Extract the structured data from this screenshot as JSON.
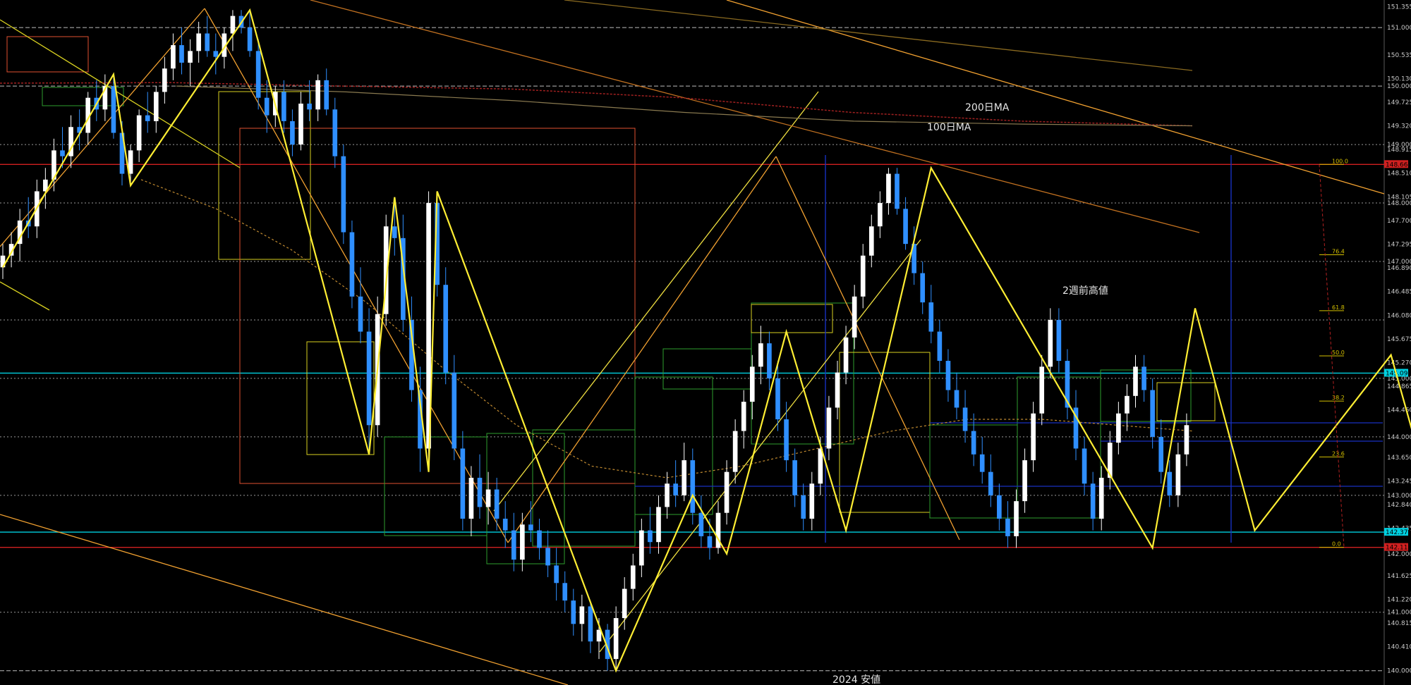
{
  "annotations": {
    "ma200": "200日MA",
    "ma100": "100日MA",
    "two_week_high": "2週前高値",
    "low_2024": "2024 安値"
  },
  "chart_data": {
    "type": "candlestick",
    "instrument_hint": "",
    "ylim": [
      139.9,
      151.4
    ],
    "y_ticks": [
      "151.355",
      "151.000",
      "150.535",
      "150.130",
      "150.000",
      "149.725",
      "149.320",
      "149.000",
      "148.915",
      "148.510",
      "148.105",
      "148.000",
      "147.700",
      "147.295",
      "147.000",
      "146.890",
      "146.485",
      "146.080",
      "145.675",
      "145.270",
      "145.000",
      "144.865",
      "144.460",
      "144.000",
      "143.650",
      "143.245",
      "143.000",
      "142.840",
      "142.435",
      "142.000",
      "141.625",
      "141.220",
      "141.000",
      "140.815",
      "140.410",
      "140.000"
    ],
    "horizontal_levels": [
      {
        "price": 151.0,
        "style": "dashed",
        "color": "#bdbdbd"
      },
      {
        "price": 150.0,
        "style": "dashed",
        "color": "#bdbdbd"
      },
      {
        "price": 149.0,
        "style": "dotted",
        "color": "#9a9a9a"
      },
      {
        "price": 148.66,
        "style": "solid",
        "color": "#d02020",
        "tag": "148.660"
      },
      {
        "price": 148.0,
        "style": "dotted",
        "color": "#9a9a9a"
      },
      {
        "price": 147.0,
        "style": "dotted",
        "color": "#9a9a9a"
      },
      {
        "price": 146.0,
        "style": "dotted",
        "color": "#9a9a9a"
      },
      {
        "price": 145.09,
        "style": "solid",
        "color": "#00d0e0",
        "tag": "145.093"
      },
      {
        "price": 145.0,
        "style": "dotted",
        "color": "#9a9a9a"
      },
      {
        "price": 144.0,
        "style": "dotted",
        "color": "#9a9a9a"
      },
      {
        "price": 143.0,
        "style": "dotted",
        "color": "#9a9a9a"
      },
      {
        "price": 142.37,
        "style": "solid",
        "color": "#00d0e0",
        "tag": "142.375"
      },
      {
        "price": 142.11,
        "style": "solid",
        "color": "#d02020",
        "tag": "142.111"
      },
      {
        "price": 141.0,
        "style": "dotted",
        "color": "#9a9a9a"
      },
      {
        "price": 140.0,
        "style": "dashed",
        "color": "#bdbdbd"
      }
    ],
    "fibonacci": {
      "high": 148.66,
      "low": 142.11,
      "levels": [
        {
          "ratio": 1.0,
          "label": "100.0"
        },
        {
          "ratio": 0.764,
          "label": "76.4"
        },
        {
          "ratio": 0.618,
          "label": "61.8"
        },
        {
          "ratio": 0.5,
          "label": "50.0"
        },
        {
          "ratio": 0.382,
          "label": "38.2"
        },
        {
          "ratio": 0.236,
          "label": "23.6"
        },
        {
          "ratio": 0.0,
          "label": "0.0"
        }
      ]
    },
    "zigzag": [
      {
        "i": 0,
        "p": 146.9
      },
      {
        "i": 13,
        "p": 150.2
      },
      {
        "i": 15,
        "p": 148.3
      },
      {
        "i": 29,
        "p": 151.3
      },
      {
        "i": 43,
        "p": 143.7
      },
      {
        "i": 46,
        "p": 148.1
      },
      {
        "i": 50,
        "p": 143.4
      },
      {
        "i": 51,
        "p": 148.2
      },
      {
        "i": 72,
        "p": 140.0
      },
      {
        "i": 81,
        "p": 143.0
      },
      {
        "i": 85,
        "p": 142.0
      },
      {
        "i": 92,
        "p": 145.8
      },
      {
        "i": 99,
        "p": 142.4
      },
      {
        "i": 109,
        "p": 148.6
      },
      {
        "i": 135,
        "p": 142.1
      },
      {
        "i": 140,
        "p": 146.2
      },
      {
        "i": 147,
        "p": 142.4
      },
      {
        "i": 163,
        "p": 145.4
      },
      {
        "i": 168,
        "p": 142.8
      },
      {
        "i": 169,
        "p": 144.4
      }
    ],
    "ma200": [
      150.05,
      150.06,
      150.0,
      149.95,
      149.8,
      149.55,
      149.4,
      149.32
    ],
    "ma100": [
      148.4,
      147.9,
      147.2,
      146.3,
      145.2,
      144.2,
      143.5,
      143.3,
      143.5,
      143.8,
      144.1,
      144.3,
      144.3,
      144.2,
      144.1
    ],
    "bars": [
      [
        146.9,
        147.3,
        146.7,
        147.1
      ],
      [
        147.1,
        147.5,
        146.9,
        147.3
      ],
      [
        147.3,
        147.9,
        147.0,
        147.7
      ],
      [
        147.7,
        148.1,
        147.4,
        147.6
      ],
      [
        147.6,
        148.4,
        147.4,
        148.2
      ],
      [
        148.2,
        148.6,
        147.9,
        148.4
      ],
      [
        148.4,
        149.1,
        148.2,
        148.9
      ],
      [
        148.9,
        149.3,
        148.6,
        148.8
      ],
      [
        148.8,
        149.5,
        148.6,
        149.3
      ],
      [
        149.3,
        149.6,
        148.9,
        149.2
      ],
      [
        149.2,
        149.9,
        149.0,
        149.8
      ],
      [
        149.8,
        150.1,
        149.4,
        149.6
      ],
      [
        149.6,
        150.2,
        149.4,
        150.0
      ],
      [
        150.0,
        150.2,
        149.1,
        149.2
      ],
      [
        149.2,
        149.4,
        148.3,
        148.5
      ],
      [
        148.5,
        149.0,
        148.3,
        148.9
      ],
      [
        148.9,
        149.6,
        148.7,
        149.5
      ],
      [
        149.5,
        149.9,
        149.2,
        149.4
      ],
      [
        149.4,
        150.0,
        149.2,
        149.9
      ],
      [
        149.9,
        150.5,
        149.7,
        150.3
      ],
      [
        150.3,
        150.9,
        150.1,
        150.7
      ],
      [
        150.7,
        151.0,
        150.2,
        150.4
      ],
      [
        150.4,
        150.8,
        150.0,
        150.6
      ],
      [
        150.6,
        151.1,
        150.4,
        150.9
      ],
      [
        150.9,
        151.2,
        150.5,
        150.6
      ],
      [
        150.6,
        150.9,
        150.2,
        150.5
      ],
      [
        150.5,
        151.0,
        150.3,
        150.9
      ],
      [
        150.9,
        151.3,
        150.6,
        151.2
      ],
      [
        151.2,
        151.3,
        150.9,
        151.0
      ],
      [
        151.0,
        151.3,
        150.5,
        150.6
      ],
      [
        150.6,
        150.8,
        149.6,
        149.8
      ],
      [
        149.8,
        150.1,
        149.2,
        149.5
      ],
      [
        149.5,
        150.0,
        149.3,
        149.9
      ],
      [
        149.9,
        150.1,
        149.2,
        149.4
      ],
      [
        149.4,
        149.6,
        148.8,
        149.0
      ],
      [
        149.0,
        149.9,
        148.9,
        149.7
      ],
      [
        149.7,
        150.1,
        149.4,
        149.6
      ],
      [
        149.6,
        150.2,
        149.4,
        150.1
      ],
      [
        150.1,
        150.3,
        149.5,
        149.6
      ],
      [
        149.6,
        149.8,
        148.6,
        148.8
      ],
      [
        148.8,
        149.0,
        147.3,
        147.5
      ],
      [
        147.5,
        147.7,
        146.2,
        146.4
      ],
      [
        146.4,
        146.9,
        145.6,
        145.8
      ],
      [
        145.8,
        146.2,
        143.7,
        144.2
      ],
      [
        144.2,
        146.4,
        144.0,
        146.1
      ],
      [
        146.1,
        147.8,
        145.9,
        147.6
      ],
      [
        147.6,
        148.1,
        147.1,
        147.4
      ],
      [
        147.4,
        147.8,
        145.8,
        146.0
      ],
      [
        146.0,
        146.4,
        144.6,
        144.8
      ],
      [
        144.8,
        145.2,
        143.4,
        143.8
      ],
      [
        143.8,
        148.2,
        143.6,
        148.0
      ],
      [
        148.0,
        148.2,
        146.4,
        146.6
      ],
      [
        146.6,
        146.9,
        144.9,
        145.1
      ],
      [
        145.1,
        145.4,
        143.6,
        143.8
      ],
      [
        143.8,
        144.1,
        142.4,
        142.6
      ],
      [
        142.6,
        143.5,
        142.3,
        143.3
      ],
      [
        143.3,
        143.7,
        142.6,
        142.8
      ],
      [
        142.8,
        143.4,
        142.5,
        143.1
      ],
      [
        143.1,
        143.3,
        142.4,
        142.6
      ],
      [
        142.6,
        142.9,
        142.1,
        142.4
      ],
      [
        142.4,
        142.7,
        141.7,
        141.9
      ],
      [
        141.9,
        142.7,
        141.7,
        142.5
      ],
      [
        142.5,
        142.9,
        142.2,
        142.4
      ],
      [
        142.4,
        142.6,
        141.9,
        142.1
      ],
      [
        142.1,
        142.4,
        141.6,
        141.8
      ],
      [
        141.8,
        142.1,
        141.2,
        141.5
      ],
      [
        141.5,
        141.7,
        141.0,
        141.2
      ],
      [
        141.2,
        141.4,
        140.6,
        140.8
      ],
      [
        140.8,
        141.3,
        140.5,
        141.1
      ],
      [
        141.1,
        141.2,
        140.3,
        140.5
      ],
      [
        140.5,
        140.9,
        140.2,
        140.7
      ],
      [
        140.7,
        140.8,
        140.0,
        140.2
      ],
      [
        140.2,
        141.1,
        140.0,
        140.9
      ],
      [
        140.9,
        141.6,
        140.7,
        141.4
      ],
      [
        141.4,
        142.0,
        141.2,
        141.8
      ],
      [
        141.8,
        142.6,
        141.6,
        142.4
      ],
      [
        142.4,
        142.8,
        142.0,
        142.2
      ],
      [
        142.2,
        143.0,
        142.0,
        142.8
      ],
      [
        142.8,
        143.4,
        142.6,
        143.2
      ],
      [
        143.2,
        143.6,
        142.8,
        143.0
      ],
      [
        143.0,
        143.9,
        142.9,
        143.6
      ],
      [
        143.6,
        143.8,
        142.5,
        142.7
      ],
      [
        142.7,
        143.0,
        142.1,
        142.3
      ],
      [
        142.3,
        142.6,
        141.9,
        142.1
      ],
      [
        142.1,
        142.9,
        142.0,
        142.7
      ],
      [
        142.7,
        143.6,
        142.5,
        143.4
      ],
      [
        143.4,
        144.3,
        143.2,
        144.1
      ],
      [
        144.1,
        144.8,
        143.8,
        144.6
      ],
      [
        144.6,
        145.4,
        144.3,
        145.2
      ],
      [
        145.2,
        145.9,
        144.9,
        145.6
      ],
      [
        145.6,
        145.8,
        144.8,
        145.0
      ],
      [
        145.0,
        145.3,
        144.1,
        144.3
      ],
      [
        144.3,
        144.6,
        143.4,
        143.6
      ],
      [
        143.6,
        143.8,
        142.8,
        143.0
      ],
      [
        143.0,
        143.2,
        142.4,
        142.6
      ],
      [
        142.6,
        143.4,
        142.4,
        143.2
      ],
      [
        143.2,
        144.0,
        143.0,
        143.8
      ],
      [
        143.8,
        144.7,
        143.6,
        144.5
      ],
      [
        144.5,
        145.3,
        144.3,
        145.1
      ],
      [
        145.1,
        145.9,
        144.9,
        145.7
      ],
      [
        145.7,
        146.6,
        145.5,
        146.4
      ],
      [
        146.4,
        147.3,
        146.2,
        147.1
      ],
      [
        147.1,
        147.8,
        146.9,
        147.6
      ],
      [
        147.6,
        148.2,
        147.4,
        148.0
      ],
      [
        148.0,
        148.6,
        147.8,
        148.5
      ],
      [
        148.5,
        148.6,
        147.8,
        147.9
      ],
      [
        147.9,
        148.1,
        147.2,
        147.3
      ],
      [
        147.3,
        147.6,
        146.6,
        146.8
      ],
      [
        146.8,
        147.0,
        146.1,
        146.3
      ],
      [
        146.3,
        146.6,
        145.6,
        145.8
      ],
      [
        145.8,
        146.0,
        145.1,
        145.3
      ],
      [
        145.3,
        145.5,
        144.6,
        144.8
      ],
      [
        144.8,
        145.1,
        144.3,
        144.5
      ],
      [
        144.5,
        144.8,
        143.9,
        144.1
      ],
      [
        144.1,
        144.4,
        143.5,
        143.7
      ],
      [
        143.7,
        144.0,
        143.2,
        143.4
      ],
      [
        143.4,
        143.7,
        142.8,
        143.0
      ],
      [
        143.0,
        143.2,
        142.4,
        142.6
      ],
      [
        142.6,
        142.9,
        142.1,
        142.3
      ],
      [
        142.3,
        143.1,
        142.1,
        142.9
      ],
      [
        142.9,
        143.8,
        142.7,
        143.6
      ],
      [
        143.6,
        144.6,
        143.4,
        144.4
      ],
      [
        144.4,
        145.4,
        144.2,
        145.2
      ],
      [
        145.2,
        146.2,
        145.0,
        146.0
      ],
      [
        146.0,
        146.2,
        145.1,
        145.3
      ],
      [
        145.3,
        145.5,
        144.3,
        144.5
      ],
      [
        144.5,
        144.8,
        143.6,
        143.8
      ],
      [
        143.8,
        144.0,
        143.0,
        143.2
      ],
      [
        143.2,
        143.4,
        142.4,
        142.6
      ],
      [
        142.6,
        143.5,
        142.4,
        143.3
      ],
      [
        143.3,
        144.1,
        143.1,
        143.9
      ],
      [
        143.9,
        144.6,
        143.7,
        144.4
      ],
      [
        144.4,
        144.9,
        144.1,
        144.7
      ],
      [
        144.7,
        145.4,
        144.5,
        145.2
      ],
      [
        145.2,
        145.4,
        144.6,
        144.8
      ],
      [
        144.8,
        145.0,
        143.8,
        144.0
      ],
      [
        144.0,
        144.3,
        143.2,
        143.4
      ],
      [
        143.4,
        143.6,
        142.8,
        143.0
      ],
      [
        143.0,
        143.9,
        142.8,
        143.7
      ],
      [
        143.7,
        144.4,
        143.5,
        144.2
      ]
    ]
  }
}
